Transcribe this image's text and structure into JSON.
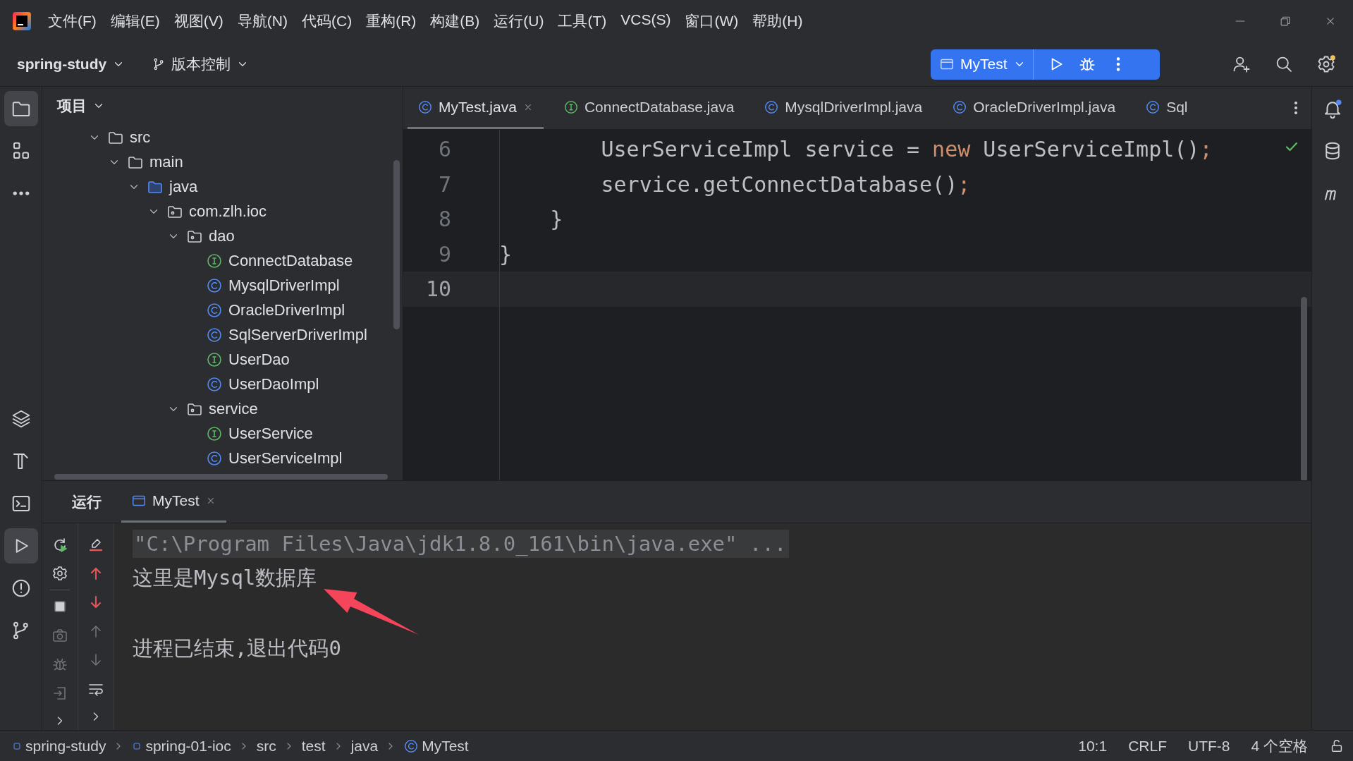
{
  "menu": [
    "文件(F)",
    "编辑(E)",
    "视图(V)",
    "导航(N)",
    "代码(C)",
    "重构(R)",
    "构建(B)",
    "运行(U)",
    "工具(T)",
    "VCS(S)",
    "窗口(W)",
    "帮助(H)"
  ],
  "toolbar": {
    "project": "spring-study",
    "vcs": "版本控制",
    "run_config": "MyTest"
  },
  "project_panel": {
    "title": "项目",
    "tree": [
      {
        "label": "src",
        "kind": "folder",
        "expanded": true,
        "children": [
          {
            "label": "main",
            "kind": "folder",
            "expanded": true,
            "children": [
              {
                "label": "java",
                "kind": "source_root",
                "expanded": true,
                "children": [
                  {
                    "label": "com.zlh.ioc",
                    "kind": "package",
                    "expanded": true,
                    "children": [
                      {
                        "label": "dao",
                        "kind": "package",
                        "expanded": true,
                        "children": [
                          {
                            "label": "ConnectDatabase",
                            "kind": "interface"
                          },
                          {
                            "label": "MysqlDriverImpl",
                            "kind": "class"
                          },
                          {
                            "label": "OracleDriverImpl",
                            "kind": "class"
                          },
                          {
                            "label": "SqlServerDriverImpl",
                            "kind": "class"
                          },
                          {
                            "label": "UserDao",
                            "kind": "interface"
                          },
                          {
                            "label": "UserDaoImpl",
                            "kind": "class"
                          }
                        ]
                      },
                      {
                        "label": "service",
                        "kind": "package",
                        "expanded": true,
                        "children": [
                          {
                            "label": "UserService",
                            "kind": "interface"
                          },
                          {
                            "label": "UserServiceImpl",
                            "kind": "class"
                          }
                        ]
                      }
                    ]
                  }
                ]
              }
            ]
          }
        ]
      }
    ]
  },
  "editor": {
    "tabs": [
      {
        "label": "MyTest.java",
        "kind": "class",
        "selected": true
      },
      {
        "label": "ConnectDatabase.java",
        "kind": "interface",
        "selected": false
      },
      {
        "label": "MysqlDriverImpl.java",
        "kind": "class",
        "selected": false
      },
      {
        "label": "OracleDriverImpl.java",
        "kind": "class",
        "selected": false
      },
      {
        "label": "Sql",
        "kind": "class",
        "selected": false
      }
    ],
    "lines": [
      {
        "number": "6",
        "current": false,
        "tokens": [
          {
            "text": "        UserServiceImpl service = ",
            "kind": "plain"
          },
          {
            "text": "new",
            "kind": "keyword"
          },
          {
            "text": " UserServiceImpl()",
            "kind": "plain"
          },
          {
            "text": ";",
            "kind": "punct"
          }
        ]
      },
      {
        "number": "7",
        "current": false,
        "tokens": [
          {
            "text": "        service.getConnectDatabase()",
            "kind": "plain"
          },
          {
            "text": ";",
            "kind": "punct"
          }
        ]
      },
      {
        "number": "8",
        "current": false,
        "tokens": [
          {
            "text": "    }",
            "kind": "plain"
          }
        ]
      },
      {
        "number": "9",
        "current": false,
        "tokens": [
          {
            "text": "}",
            "kind": "plain"
          }
        ]
      },
      {
        "number": "10",
        "current": true
      }
    ]
  },
  "run_panel": {
    "title": "运行",
    "tabs": [
      {
        "label": "MyTest",
        "selected": true
      }
    ],
    "console": [
      {
        "text": "\"C:\\Program Files\\Java\\jdk1.8.0_161\\bin\\java.exe\" ...",
        "kind": "command"
      },
      {
        "text": "这里是Mysql数据库",
        "kind": "output"
      },
      {
        "text": "进程已结束,退出代码0",
        "kind": "exit"
      }
    ]
  },
  "breadcrumbs": [
    {
      "label": "spring-study",
      "kind": "module"
    },
    {
      "label": "spring-01-ioc",
      "kind": "module"
    },
    {
      "label": "src",
      "kind": "folder"
    },
    {
      "label": "test",
      "kind": "folder"
    },
    {
      "label": "java",
      "kind": "folder"
    },
    {
      "label": "MyTest",
      "kind": "class"
    }
  ],
  "status": [
    "10:1",
    "CRLF",
    "UTF-8",
    "4 个空格"
  ]
}
